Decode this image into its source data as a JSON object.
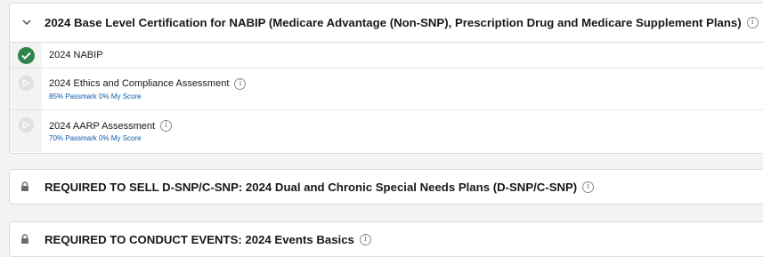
{
  "sections": {
    "main": {
      "title": "2024 Base Level Certification for NABIP (Medicare Advantage (Non-SNP), Prescription Drug and Medicare Supplement Plans)",
      "items": [
        {
          "title": "2024 NABIP",
          "status": "completed"
        },
        {
          "title": "2024 Ethics and Compliance Assessment",
          "subtitle": "85% Passmark 0% My Score",
          "status": "not-started"
        },
        {
          "title": "2024 AARP Assessment",
          "subtitle": "70% Passmark 0% My Score",
          "status": "not-started"
        }
      ]
    },
    "dsnp": {
      "title": "REQUIRED TO SELL D-SNP/C-SNP: 2024 Dual and Chronic Special Needs Plans (D-SNP/C-SNP)",
      "status": "locked"
    },
    "events": {
      "title": "REQUIRED TO CONDUCT EVENTS: 2024 Events Basics",
      "status": "locked"
    }
  },
  "icons": {
    "info": "i",
    "expand": "chevron-down-icon",
    "complete": "check-icon",
    "pending": "play-icon",
    "locked": "lock-icon"
  },
  "colors": {
    "complete": "#2e844a",
    "link": "#0b5cab",
    "background": "#f3f3f3"
  }
}
